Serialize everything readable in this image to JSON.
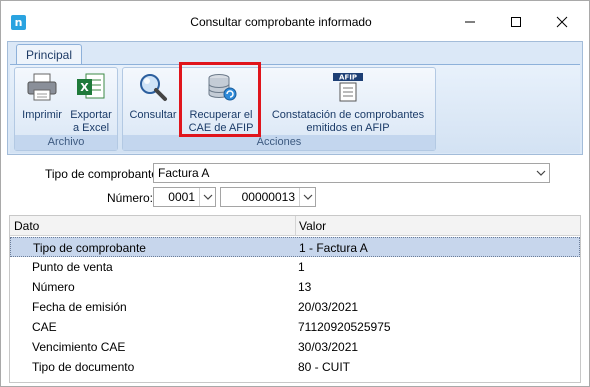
{
  "window": {
    "title": "Consultar comprobante informado",
    "app_icon_letter": "n"
  },
  "ribbon": {
    "tab_label": "Principal",
    "groups": [
      {
        "label": "Archivo",
        "buttons": [
          "Imprimir",
          "Exportar a Excel"
        ]
      },
      {
        "label": "Acciones",
        "buttons": [
          "Consultar",
          "Recuperar el CAE de AFIP",
          "Constatación de comprobantes emitidos en AFIP"
        ]
      }
    ],
    "btn_imprimir": "Imprimir",
    "btn_exportar_l1": "Exportar",
    "btn_exportar_l2": "a Excel",
    "btn_consultar": "Consultar",
    "btn_recuperar_l1": "Recuperar el",
    "btn_recuperar_l2": "CAE de AFIP",
    "btn_constatacion_l1": "Constatación de comprobantes",
    "btn_constatacion_l2": "emitidos en AFIP",
    "group_archivo": "Archivo",
    "group_acciones": "Acciones",
    "afip_logo_text": "AFIP"
  },
  "form": {
    "tipo_label": "Tipo de comprobante",
    "tipo_value": "Factura A",
    "numero_label": "Número:",
    "punto_value": "0001",
    "numero_value": "00000013"
  },
  "grid": {
    "headers": {
      "dato": "Dato",
      "valor": "Valor"
    },
    "rows": [
      {
        "dato": "Tipo de comprobante",
        "valor": "1 - Factura A"
      },
      {
        "dato": "Punto de venta",
        "valor": "1"
      },
      {
        "dato": "Número",
        "valor": "13"
      },
      {
        "dato": "Fecha de emisión",
        "valor": "20/03/2021"
      },
      {
        "dato": "CAE",
        "valor": "71120920525975"
      },
      {
        "dato": "Vencimiento CAE",
        "valor": "30/03/2021"
      },
      {
        "dato": "Tipo de documento",
        "valor": "80 - CUIT"
      }
    ]
  },
  "colors": {
    "ribbon_bg": "#dbe8f7",
    "highlight": "#e0151c",
    "selected_row": "#c7d6ec"
  }
}
